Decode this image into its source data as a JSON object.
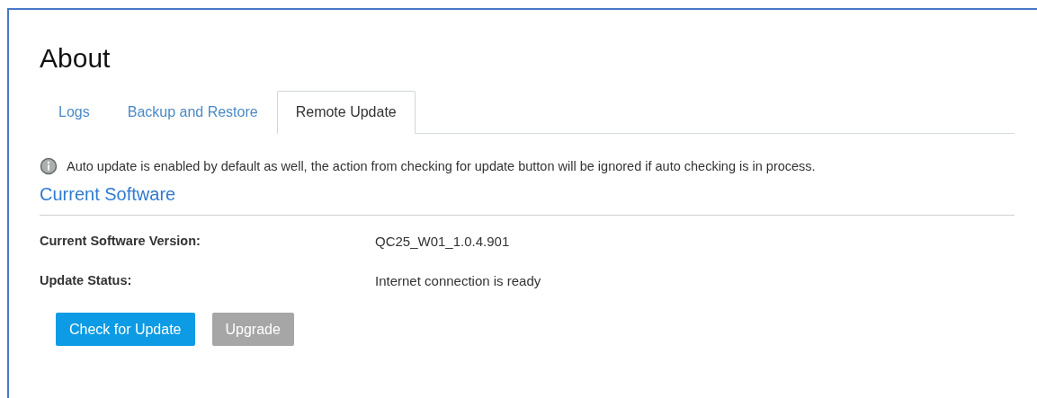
{
  "page": {
    "title": "About"
  },
  "tabs": [
    {
      "label": "Logs",
      "selected": false
    },
    {
      "label": "Backup and Restore",
      "selected": false
    },
    {
      "label": "Remote Update",
      "selected": true
    }
  ],
  "notice": "Auto update is enabled by default as well, the action from checking for update button will be ignored if auto checking is in process.",
  "section": {
    "title": "Current Software"
  },
  "fields": [
    {
      "label": "Current Software Version:",
      "value": "QC25_W01_1.0.4.901"
    },
    {
      "label": "Update Status:",
      "value": "Internet connection is ready"
    }
  ],
  "buttons": [
    {
      "label": "Check for Update",
      "disabled": false
    },
    {
      "label": "Upgrade",
      "disabled": true
    }
  ]
}
